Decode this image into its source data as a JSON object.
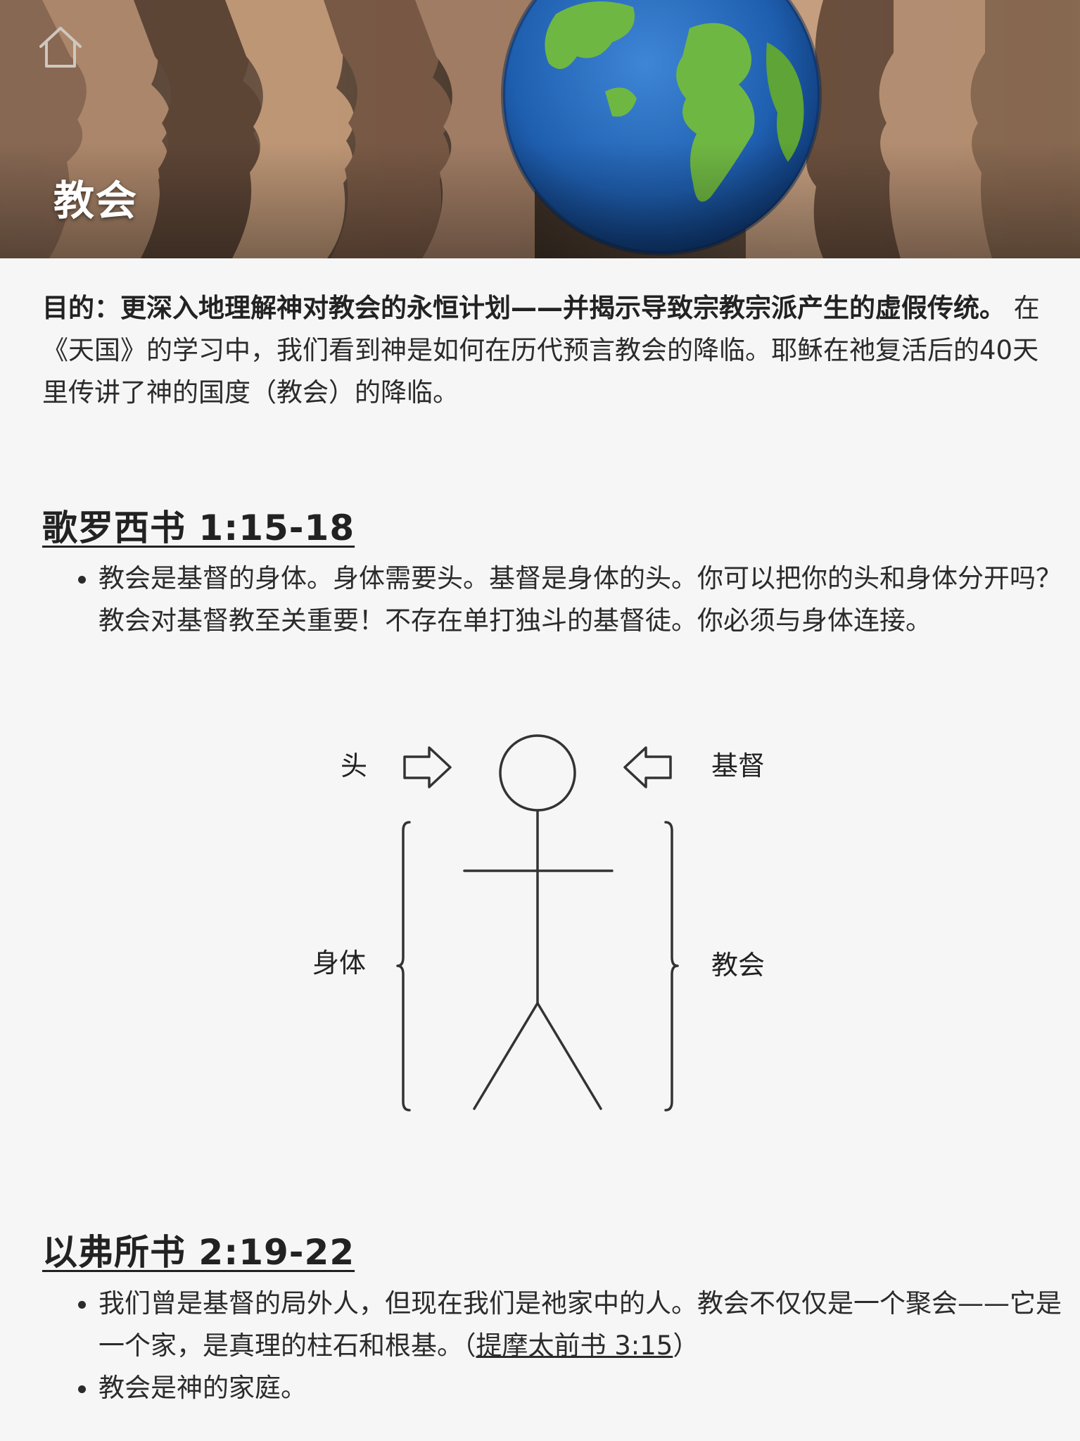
{
  "hero": {
    "title": "教会",
    "home_icon": "home-icon"
  },
  "intro": {
    "purpose": "目的：更深入地理解神对教会的永恒计划——并揭示导致宗教宗派产生的虚假传统。",
    "body": " 在《天国》的学习中，我们看到神是如何在历代预言教会的降临。耶稣在祂复活后的40天里传讲了神的国度（教会）的降临。"
  },
  "sections": [
    {
      "heading": "歌罗西书 1:15-18",
      "bullets": [
        "教会是基督的身体。身体需要头。基督是身体的头。你可以把你的头和身体分开吗？教会对基督教至关重要！不存在单打独斗的基督徒。你必须与身体连接。"
      ]
    },
    {
      "heading": "以弗所书 2:19-22",
      "bullets": [
        {
          "text": "我们曾是基督的局外人，但现在我们是祂家中的人。教会不仅仅是一个聚会——它是一个家，是真理的柱石和根基。（",
          "link": "提摩太前书 3:15",
          "after": "）"
        },
        "教会是神的家庭。"
      ]
    }
  ],
  "diagram": {
    "head_label": "头",
    "christ_label": "基督",
    "body_label": "身体",
    "church_label": "教会",
    "line_color": "#333333"
  },
  "colors": {
    "background": "#f6f6f6",
    "text": "#222222",
    "hero_title": "#ffffff"
  }
}
